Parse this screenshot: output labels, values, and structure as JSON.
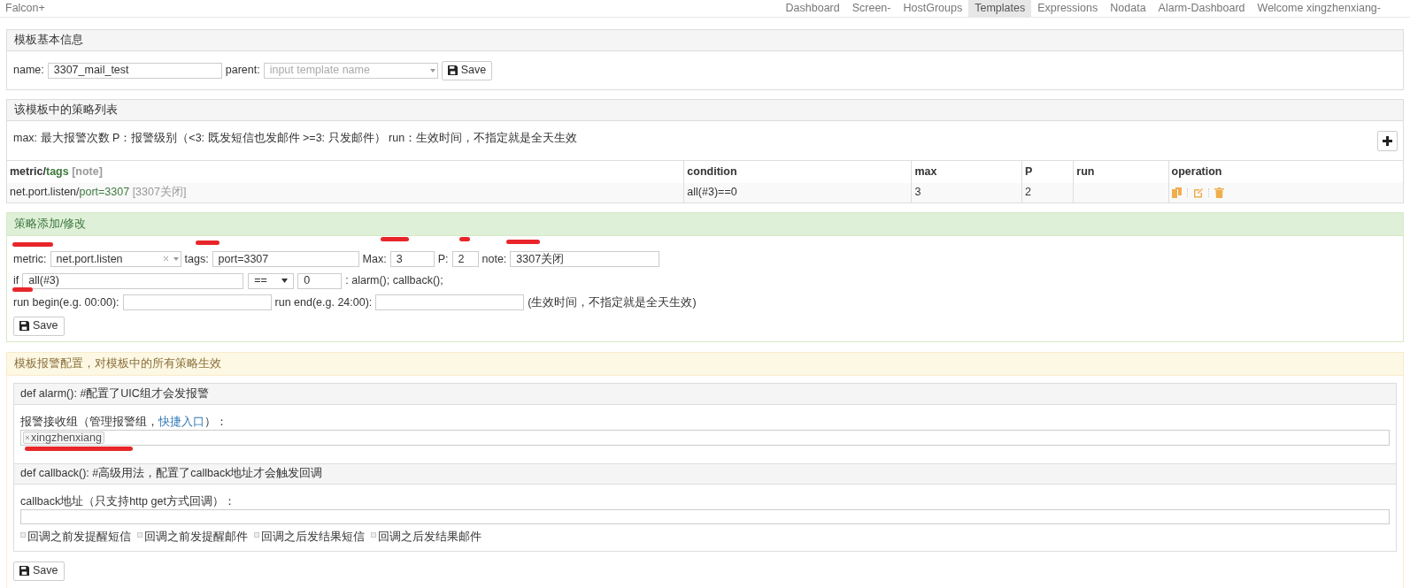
{
  "brand": "Falcon+",
  "nav": [
    {
      "label": "Dashboard",
      "selected": false
    },
    {
      "label": "Screen-",
      "selected": false
    },
    {
      "label": "HostGroups",
      "selected": false
    },
    {
      "label": "Templates",
      "selected": true
    },
    {
      "label": "Expressions",
      "selected": false
    },
    {
      "label": "Nodata",
      "selected": false
    },
    {
      "label": "Alarm-Dashboard",
      "selected": false
    },
    {
      "label": "Welcome xingzhenxiang-",
      "selected": false
    }
  ],
  "basic_panel": {
    "title": "模板基本信息",
    "name_label": "name:",
    "name_value": "3307_mail_test",
    "parent_label": "parent:",
    "parent_placeholder": "input template name",
    "save_button": "Save"
  },
  "strategy_panel": {
    "title": "该模板中的策略列表",
    "legend": "max: 最大报警次数 P：报警级别（<3: 既发短信也发邮件 >=3: 只发邮件） run：生效时间，不指定就是全天生效",
    "columns": [
      {
        "parts": [
          {
            "kind": "metric",
            "text": "metric/"
          },
          {
            "kind": "tags",
            "text": "tags"
          },
          {
            "kind": "note",
            "text": " [note]"
          }
        ]
      },
      {
        "label": "condition"
      },
      {
        "label": "max"
      },
      {
        "label": "P"
      },
      {
        "label": "run"
      },
      {
        "label": "operation"
      }
    ],
    "rows": [
      {
        "metric": [
          {
            "kind": "metric",
            "text": "net.port.listen/"
          },
          {
            "kind": "tags",
            "text": "port=3307"
          },
          {
            "kind": "note",
            "text": " [3307关闭]"
          }
        ],
        "condition": "all(#3)==0",
        "max": "3",
        "p": "2"
      }
    ]
  },
  "strategy_form": {
    "title": "策略添加/修改",
    "metric_label": "metric:",
    "metric_value": "net.port.listen",
    "tags_label": "tags:",
    "tags_value": "port=3307",
    "max_label": "Max:",
    "max_value": "3",
    "p_label": "P:",
    "p_value": "2",
    "note_label": "note:",
    "note_value": "3307关闭",
    "if_label": "if",
    "func_value": "all(#3)",
    "operator": "==",
    "threshold": "0",
    "action_text": ": alarm(); callback();",
    "run_begin_label": "run begin(e.g. 00:00):",
    "run_end_label": "run end(e.g. 24:00):",
    "run_hint": "(生效时间，不指定就是全天生效)",
    "save_button": "Save"
  },
  "alarm_panel": {
    "title": "模板报警配置，对模板中的所有策略生效",
    "alarm_title": "def alarm(): #配置了UIC组才会发报警",
    "receiver_label": "报警接收组（管理报警组，",
    "receiver_link": "快捷入口",
    "receiver_label_end": "）：",
    "receivers": [
      "xingzhenxiang"
    ],
    "callback_title": "def callback(): #高级用法，配置了callback地址才会触发回调",
    "callback_label": "callback地址（只支持http get方式回调）：",
    "options": [
      {
        "label": "回调之前发提醒短信",
        "checked": false
      },
      {
        "label": "回调之前发提醒邮件",
        "checked": false
      },
      {
        "label": "回调之后发结果短信",
        "checked": false
      },
      {
        "label": "回调之后发结果邮件",
        "checked": false
      }
    ],
    "save_button": "Save"
  }
}
